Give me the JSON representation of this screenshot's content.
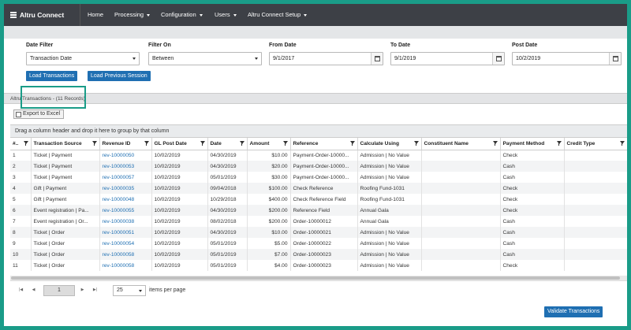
{
  "app": {
    "title": "Altru Connect"
  },
  "nav": [
    {
      "label": "Home",
      "dropdown": false
    },
    {
      "label": "Processing",
      "dropdown": true
    },
    {
      "label": "Configuration",
      "dropdown": true
    },
    {
      "label": "Users",
      "dropdown": true
    },
    {
      "label": "Altru Connect Setup",
      "dropdown": true
    }
  ],
  "filters": {
    "date_filter": {
      "label": "Date Filter",
      "value": "Transaction Date"
    },
    "filter_on": {
      "label": "Filter On",
      "value": "Between"
    },
    "from_date": {
      "label": "From Date",
      "value": "9/1/2017"
    },
    "to_date": {
      "label": "To Date",
      "value": "9/1/2019"
    },
    "post_date": {
      "label": "Post Date",
      "value": "10/2/2019"
    }
  },
  "actions": {
    "load_transactions": "Load Transactions",
    "load_previous": "Load Previous Session",
    "export_excel": "Export to Excel",
    "validate": "Validate Transactions"
  },
  "records_label": "Altru Transactions - (11 Records)",
  "grid": {
    "group_hint": "Drag a column header and drop it here to group by that column",
    "columns": [
      "#..",
      "Transaction Source",
      "Revenue ID",
      "GL Post Date",
      "Date",
      "Amount",
      "Reference",
      "Calculate Using",
      "Constituent Name",
      "Payment Method",
      "Credit Type"
    ],
    "rows": [
      [
        "1",
        "Ticket | Payment",
        "rev-10000050",
        "10/02/2019",
        "04/30/2019",
        "$10.00",
        "Payment-Order-10000...",
        "Admission | No Value",
        "",
        "Check",
        ""
      ],
      [
        "2",
        "Ticket | Payment",
        "rev-10000053",
        "10/02/2019",
        "04/30/2019",
        "$20.00",
        "Payment-Order-10000...",
        "Admission | No Value",
        "",
        "Cash",
        ""
      ],
      [
        "3",
        "Ticket | Payment",
        "rev-10000057",
        "10/02/2019",
        "05/01/2019",
        "$30.00",
        "Payment-Order-10000...",
        "Admission | No Value",
        "",
        "Cash",
        ""
      ],
      [
        "4",
        "Gift | Payment",
        "rev-10000035",
        "10/02/2019",
        "09/04/2018",
        "$100.00",
        "Check Reference",
        "Roofing Fund-1031",
        "",
        "Check",
        ""
      ],
      [
        "5",
        "Gift | Payment",
        "rev-10000048",
        "10/02/2019",
        "10/29/2018",
        "$400.00",
        "Check Reference Field",
        "Roofing Fund-1031",
        "",
        "Check",
        ""
      ],
      [
        "6",
        "Event registration | Pa...",
        "rev-10000055",
        "10/02/2019",
        "04/30/2019",
        "$200.00",
        "Reference Field",
        "Annual Gala",
        "",
        "Check",
        ""
      ],
      [
        "7",
        "Event registration | Or...",
        "rev-10000038",
        "10/02/2019",
        "08/02/2018",
        "$200.00",
        "Order-10000012",
        "Annual Gala",
        "",
        "Cash",
        ""
      ],
      [
        "8",
        "Ticket | Order",
        "rev-10000051",
        "10/02/2019",
        "04/30/2019",
        "$10.00",
        "Order-10000021",
        "Admission | No Value",
        "",
        "Cash",
        ""
      ],
      [
        "9",
        "Ticket | Order",
        "rev-10000054",
        "10/02/2019",
        "05/01/2019",
        "$5.00",
        "Order-10000022",
        "Admission | No Value",
        "",
        "Cash",
        ""
      ],
      [
        "10",
        "Ticket | Order",
        "rev-10000058",
        "10/02/2019",
        "05/01/2019",
        "$7.00",
        "Order-10000023",
        "Admission | No Value",
        "",
        "Cash",
        ""
      ],
      [
        "11",
        "Ticket | Order",
        "rev-10000058",
        "10/02/2019",
        "05/01/2019",
        "$4.00",
        "Order-10000023",
        "Admission | No Value",
        "",
        "Check",
        ""
      ]
    ]
  },
  "pager": {
    "first": "|◀",
    "prev": "◀",
    "page": "1",
    "next": "▶",
    "last": "▶|",
    "page_size": "25",
    "items_label": "items per page"
  },
  "colors": {
    "accent": "#1a9c88",
    "primary": "#1f6fb2",
    "topbar": "#3d4046"
  }
}
